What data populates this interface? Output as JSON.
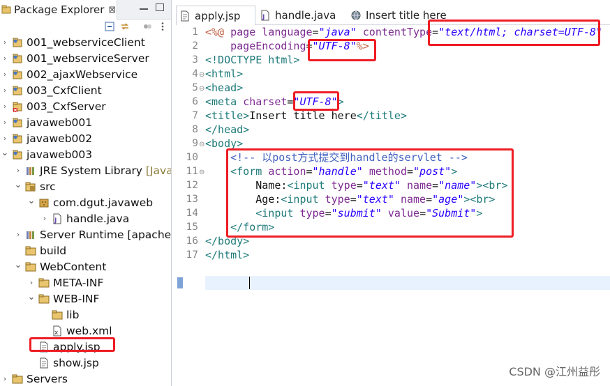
{
  "package_explorer": {
    "title": "Package Explorer",
    "close": "⊠",
    "items": [
      {
        "label": "001_webserviceClient",
        "icon": "web-project-icon",
        "chevron": "right"
      },
      {
        "label": "001_webserviceServer",
        "icon": "web-project-icon",
        "chevron": "right"
      },
      {
        "label": "002_ajaxWebservice",
        "icon": "web-project-icon",
        "chevron": "right"
      },
      {
        "label": "003_CxfClient",
        "icon": "web-project-icon",
        "chevron": "right"
      },
      {
        "label": "003_CxfServer",
        "icon": "web-project-error-icon",
        "chevron": "right"
      },
      {
        "label": "javaweb001",
        "icon": "web-project-icon",
        "chevron": "right"
      },
      {
        "label": "javaweb002",
        "icon": "web-project-icon",
        "chevron": "right"
      },
      {
        "label": "javaweb003",
        "icon": "web-project-icon",
        "chevron": "down"
      },
      {
        "label": "JRE System Library",
        "decor": "[JavaSE",
        "icon": "library-icon",
        "chevron": "right"
      },
      {
        "label": "src",
        "icon": "source-folder-icon",
        "chevron": "down"
      },
      {
        "label": "com.dgut.javaweb",
        "icon": "package-icon",
        "chevron": "down"
      },
      {
        "label": "handle.java",
        "icon": "java-file-icon",
        "chevron": "right"
      },
      {
        "label": "Server Runtime [apache-to",
        "icon": "library-icon",
        "chevron": "right"
      },
      {
        "label": "build",
        "icon": "folder-icon",
        "chevron": ""
      },
      {
        "label": "WebContent",
        "icon": "folder-icon",
        "chevron": "down"
      },
      {
        "label": "META-INF",
        "icon": "folder-icon",
        "chevron": "right"
      },
      {
        "label": "WEB-INF",
        "icon": "folder-icon",
        "chevron": "down"
      },
      {
        "label": "lib",
        "icon": "folder-icon",
        "chevron": ""
      },
      {
        "label": "web.xml",
        "icon": "xml-file-icon",
        "chevron": ""
      },
      {
        "label": "apply.jsp",
        "icon": "jsp-file-icon",
        "chevron": ""
      },
      {
        "label": "show.jsp",
        "icon": "jsp-file-icon",
        "chevron": ""
      },
      {
        "label": "Servers",
        "icon": "folder-icon",
        "chevron": "right"
      }
    ]
  },
  "editor": {
    "tabs": [
      {
        "label": "apply.jsp",
        "icon": "jsp-file-icon",
        "active": true
      },
      {
        "label": "handle.java",
        "icon": "java-file-icon",
        "active": false
      },
      {
        "label": "Insert title here",
        "icon": "globe-icon",
        "active": false
      }
    ],
    "line_numbers": [
      "1",
      "2",
      "3",
      "4",
      "5",
      "6",
      "7",
      "8",
      "9",
      "10",
      "11",
      "12",
      "13",
      "14",
      "15",
      "16",
      "17"
    ],
    "fold_markers": [
      "4",
      "5",
      "9",
      "11"
    ],
    "lines": [
      [
        [
          "jsp",
          "<%@ "
        ],
        [
          "attr",
          "page "
        ],
        [
          "attr",
          "language"
        ],
        [
          "txt",
          "="
        ],
        [
          "val",
          "\"java\""
        ],
        [
          "txt",
          " "
        ],
        [
          "attr",
          "contentType"
        ],
        [
          "txt",
          "="
        ],
        [
          "val",
          "\"text/html; charset=UTF-8\""
        ]
      ],
      [
        [
          "txt",
          "    "
        ],
        [
          "attr",
          "pageEncoding"
        ],
        [
          "txt",
          "="
        ],
        [
          "val",
          "\"UTF-8\""
        ],
        [
          "jsp",
          "%>"
        ]
      ],
      [
        [
          "tag",
          "<!DOCTYPE html>"
        ]
      ],
      [
        [
          "tag",
          "<html>"
        ]
      ],
      [
        [
          "tag",
          "<head>"
        ]
      ],
      [
        [
          "tag",
          "<meta "
        ],
        [
          "attr",
          "charset"
        ],
        [
          "txt",
          "="
        ],
        [
          "val",
          "\"UTF-8\""
        ],
        [
          "tag",
          ">"
        ]
      ],
      [
        [
          "tag",
          "<title>"
        ],
        [
          "txt",
          "Insert title here"
        ],
        [
          "tag",
          "</title>"
        ]
      ],
      [
        [
          "tag",
          "</head>"
        ]
      ],
      [
        [
          "tag",
          "<body>"
        ]
      ],
      [
        [
          "txt",
          "    "
        ],
        [
          "cmt",
          "<!-- 以post方式提交到handle的servlet -->"
        ]
      ],
      [
        [
          "txt",
          "    "
        ],
        [
          "tag",
          "<form "
        ],
        [
          "attr",
          "action"
        ],
        [
          "txt",
          "="
        ],
        [
          "val",
          "\"handle\""
        ],
        [
          "txt",
          " "
        ],
        [
          "attr",
          "method"
        ],
        [
          "txt",
          "="
        ],
        [
          "val",
          "\"post\""
        ],
        [
          "tag",
          ">"
        ]
      ],
      [
        [
          "txt",
          "        Name:"
        ],
        [
          "tag",
          "<input "
        ],
        [
          "attr",
          "type"
        ],
        [
          "txt",
          "="
        ],
        [
          "val",
          "\"text\""
        ],
        [
          "txt",
          " "
        ],
        [
          "attr",
          "name"
        ],
        [
          "txt",
          "="
        ],
        [
          "val",
          "\"name\""
        ],
        [
          "tag",
          ">"
        ],
        [
          "tag",
          "<br>"
        ]
      ],
      [
        [
          "txt",
          "        Age:"
        ],
        [
          "tag",
          "<input "
        ],
        [
          "attr",
          "type"
        ],
        [
          "txt",
          "="
        ],
        [
          "val",
          "\"text\""
        ],
        [
          "txt",
          " "
        ],
        [
          "attr",
          "name"
        ],
        [
          "txt",
          "="
        ],
        [
          "val",
          "\"age\""
        ],
        [
          "tag",
          ">"
        ],
        [
          "tag",
          "<br>"
        ]
      ],
      [
        [
          "txt",
          "        "
        ],
        [
          "tag",
          "<input "
        ],
        [
          "attr",
          "type"
        ],
        [
          "txt",
          "="
        ],
        [
          "val",
          "\"submit\""
        ],
        [
          "txt",
          " "
        ],
        [
          "attr",
          "value"
        ],
        [
          "txt",
          "="
        ],
        [
          "val",
          "\"Submit\""
        ],
        [
          "tag",
          ">"
        ]
      ],
      [
        [
          "txt",
          "    "
        ],
        [
          "tag",
          "</form>"
        ]
      ],
      [
        [
          "tag",
          "</body>"
        ]
      ],
      [
        [
          "tag",
          "</html>"
        ]
      ]
    ]
  },
  "watermark": "CSDN @江州益彤",
  "colors": {
    "highlight": "#ee1c24",
    "tag": "#1f7a7a",
    "attribute": "#7d2a91",
    "value": "#2a00ff",
    "comment": "#3f5fbf"
  }
}
